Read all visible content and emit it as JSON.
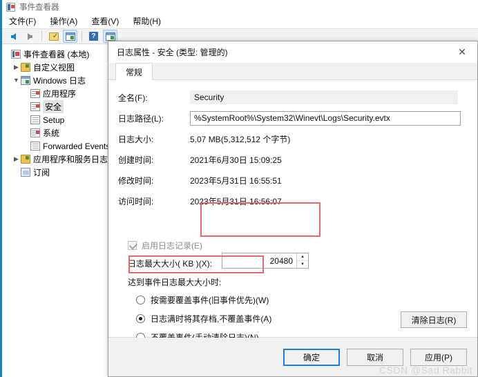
{
  "app": {
    "title": "事件查看器",
    "icon": "event-viewer-icon",
    "menu": [
      {
        "label": "文件(F)"
      },
      {
        "label": "操作(A)"
      },
      {
        "label": "查看(V)"
      },
      {
        "label": "帮助(H)"
      }
    ],
    "toolbar": [
      {
        "name": "back-arrow-icon",
        "kind": "back",
        "selected": false
      },
      {
        "name": "forward-arrow-icon",
        "kind": "forward",
        "selected": false
      },
      {
        "name": "separator",
        "kind": "sep",
        "selected": false
      },
      {
        "name": "properties-icon",
        "kind": "props",
        "selected": false
      },
      {
        "name": "show-hide-console-tree-icon",
        "kind": "win",
        "selected": true
      },
      {
        "name": "separator",
        "kind": "sep",
        "selected": false
      },
      {
        "name": "help-icon",
        "kind": "help",
        "selected": false
      },
      {
        "name": "show-hide-action-pane-icon",
        "kind": "win",
        "selected": true
      }
    ]
  },
  "tree": {
    "items": [
      {
        "label": "事件查看器 (本地)",
        "icon": "event-viewer-icon",
        "indent": 0,
        "twisty": "",
        "selected": false
      },
      {
        "label": "自定义视图",
        "icon": "folder-icon",
        "indent": 1,
        "twisty": "▶",
        "selected": false
      },
      {
        "label": "Windows 日志",
        "icon": "windows-logs-icon",
        "indent": 1,
        "twisty": "▼",
        "selected": false
      },
      {
        "label": "应用程序",
        "icon": "log-red-icon",
        "indent": 2,
        "twisty": "",
        "selected": false
      },
      {
        "label": "安全",
        "icon": "log-red-icon",
        "indent": 2,
        "twisty": "",
        "selected": true
      },
      {
        "label": "Setup",
        "icon": "log-icon",
        "indent": 2,
        "twisty": "",
        "selected": false
      },
      {
        "label": "系统",
        "icon": "log-red-icon",
        "indent": 2,
        "twisty": "",
        "selected": false
      },
      {
        "label": "Forwarded Events",
        "icon": "log-icon",
        "indent": 2,
        "twisty": "",
        "selected": false
      },
      {
        "label": "应用程序和服务日志",
        "icon": "folder-icon",
        "indent": 1,
        "twisty": "▶",
        "selected": false
      },
      {
        "label": "订阅",
        "icon": "subscriptions-icon",
        "indent": 1,
        "twisty": "",
        "selected": false
      }
    ]
  },
  "dialog": {
    "title": "日志属性 - 安全 (类型: 管理的)",
    "close_icon": "close-icon",
    "tab": "常规",
    "fields": [
      {
        "label": "全名(F):",
        "value": "Security",
        "style": "readonly"
      },
      {
        "label": "日志路径(L):",
        "value": "%SystemRoot%\\System32\\Winevt\\Logs\\Security.evtx",
        "style": "textbox"
      },
      {
        "label": "日志大小:",
        "value": "5.07 MB(5,312,512 个字节)",
        "style": "plain"
      },
      {
        "label": "创建时间:",
        "value": "2021年6月30日 15:09:25",
        "style": "plain"
      },
      {
        "label": "修改时间:",
        "value": "2023年5月31日 16:55:51",
        "style": "plain"
      },
      {
        "label": "访问时间:",
        "value": "2023年5月31日 16:56:07",
        "style": "plain"
      }
    ],
    "enable_logging": {
      "label": "启用日志记录(E)",
      "checked": true,
      "disabled": true
    },
    "max_size": {
      "label": "日志最大大小( KB )(X):",
      "value": "20480",
      "spin_up_icon": "spin-up-icon",
      "spin_down_icon": "spin-down-icon"
    },
    "when_full_label": "达到事件日志最大大小时:",
    "radios": [
      {
        "label": "按需要覆盖事件(旧事件优先)(W)",
        "selected": false
      },
      {
        "label": "日志满时将其存档,不覆盖事件(A)",
        "selected": true
      },
      {
        "label": "不覆盖事件(手动清除日志)(N)",
        "selected": false
      }
    ],
    "clear_log_button": "清除日志(R)",
    "buttons": [
      {
        "label": "确定",
        "default": true
      },
      {
        "label": "取消",
        "default": false
      },
      {
        "label": "应用(P)",
        "default": false
      }
    ]
  },
  "annotations": {
    "accent_color": "#e8686b",
    "boxes": [
      {
        "name": "max-size-highlight"
      },
      {
        "name": "archive-option-highlight"
      }
    ]
  },
  "watermark": "CSDN @Sad Rabbit"
}
